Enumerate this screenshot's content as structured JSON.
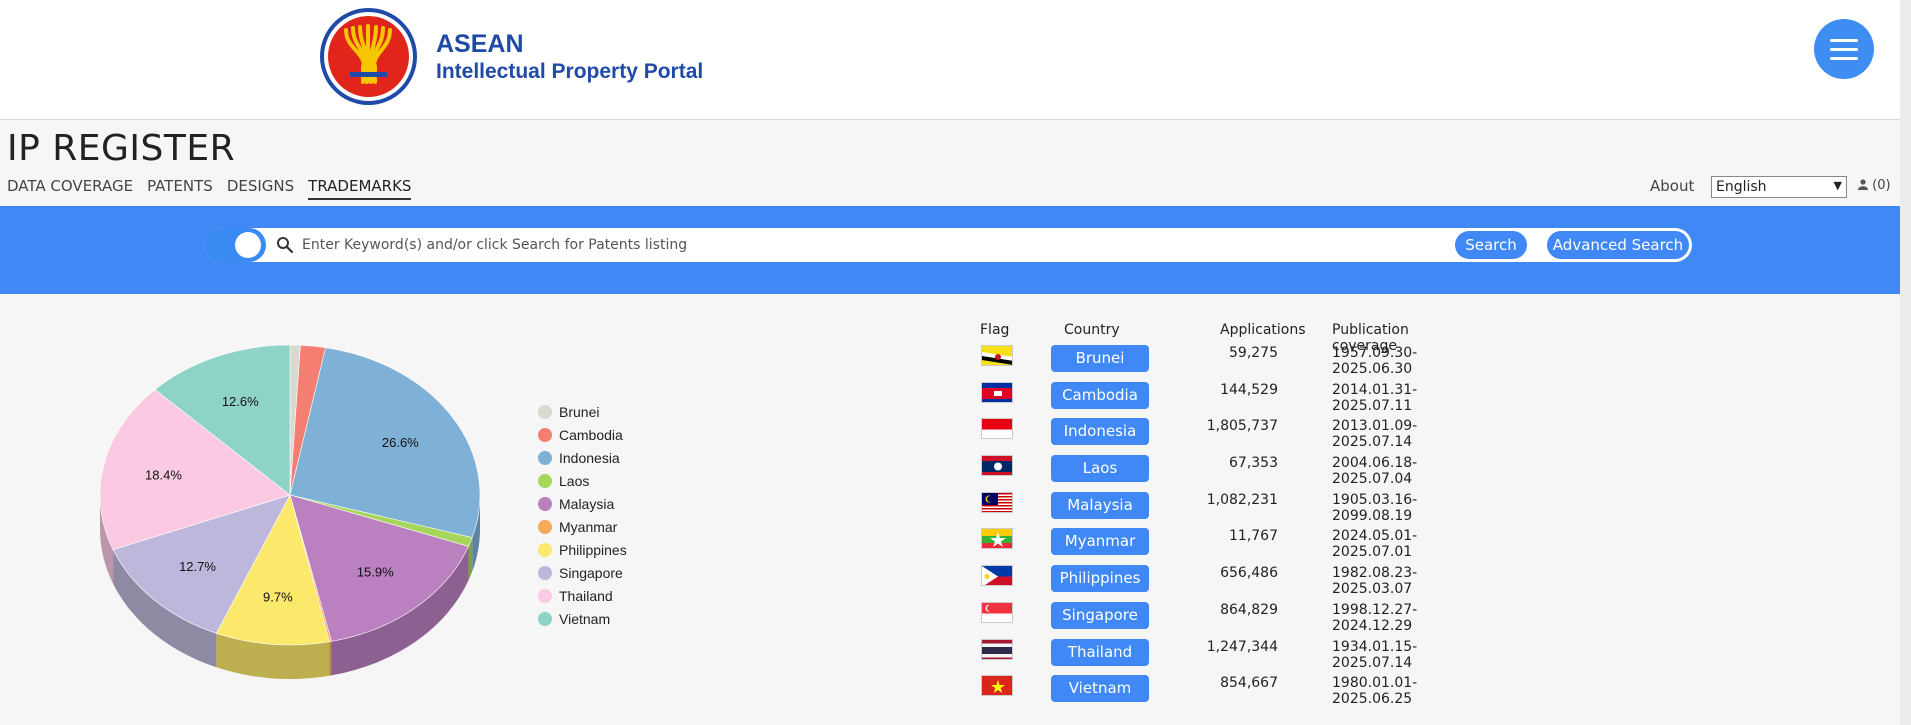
{
  "header": {
    "brand_line1": "ASEAN",
    "brand_line2": "Intellectual Property Portal",
    "logo_icon": "asean-rice-sheaf-icon",
    "menu_icon": "hamburger-icon"
  },
  "page": {
    "title": "IP REGISTER"
  },
  "nav": {
    "tabs": [
      {
        "label": "DATA COVERAGE"
      },
      {
        "label": "PATENTS"
      },
      {
        "label": "DESIGNS"
      },
      {
        "label": "TRADEMARKS",
        "active": true
      }
    ],
    "about": "About",
    "language": "English",
    "cart": "(0)"
  },
  "search": {
    "placeholder": "Enter Keyword(s) and/or click Search for Patents listing",
    "value": "",
    "search_label": "Search",
    "advanced_label": "Advanced Search",
    "toggle_on": true
  },
  "chart_data": {
    "type": "pie",
    "title": "",
    "categories": [
      "Brunei",
      "Cambodia",
      "Indonesia",
      "Laos",
      "Malaysia",
      "Myanmar",
      "Philippines",
      "Singapore",
      "Thailand",
      "Vietnam"
    ],
    "values": [
      59275,
      144529,
      1805737,
      67353,
      1082231,
      11767,
      656486,
      864829,
      1247344,
      854667
    ],
    "slice_labels": [
      "",
      "",
      "26.6%",
      "",
      "15.9%",
      "",
      "9.7%",
      "12.7%",
      "18.4%",
      "12.6%"
    ],
    "colors": [
      "#d9d9d1",
      "#f47e72",
      "#7fb0d6",
      "#a6d75a",
      "#ba80c0",
      "#f6a95a",
      "#fce86a",
      "#bdb8db",
      "#fbc9e1",
      "#8dd4c6"
    ],
    "legend_position": "right",
    "style": "3d"
  },
  "table": {
    "headers": [
      "Flag",
      "Country",
      "Applications",
      "Publication coverage"
    ],
    "rows": [
      {
        "flag": "brunei-flag-icon",
        "country": "Brunei",
        "applications": "59,275",
        "coverage": "1957.09.30-2025.06.30"
      },
      {
        "flag": "cambodia-flag-icon",
        "country": "Cambodia",
        "applications": "144,529",
        "coverage": "2014.01.31-2025.07.11"
      },
      {
        "flag": "indonesia-flag-icon",
        "country": "Indonesia",
        "applications": "1,805,737",
        "coverage": "2013.01.09-2025.07.14"
      },
      {
        "flag": "laos-flag-icon",
        "country": "Laos",
        "applications": "67,353",
        "coverage": "2004.06.18-2025.07.04"
      },
      {
        "flag": "malaysia-flag-icon",
        "country": "Malaysia",
        "applications": "1,082,231",
        "coverage": "1905.03.16-2099.08.19"
      },
      {
        "flag": "myanmar-flag-icon",
        "country": "Myanmar",
        "applications": "11,767",
        "coverage": "2024.05.01-2025.07.01"
      },
      {
        "flag": "philippines-flag-icon",
        "country": "Philippines",
        "applications": "656,486",
        "coverage": "1982.08.23-2025.03.07"
      },
      {
        "flag": "singapore-flag-icon",
        "country": "Singapore",
        "applications": "864,829",
        "coverage": "1998.12.27-2024.12.29"
      },
      {
        "flag": "thailand-flag-icon",
        "country": "Thailand",
        "applications": "1,247,344",
        "coverage": "1934.01.15-2025.07.14"
      },
      {
        "flag": "vietnam-flag-icon",
        "country": "Vietnam",
        "applications": "854,667",
        "coverage": "1980.01.01-2025.06.25"
      }
    ]
  }
}
